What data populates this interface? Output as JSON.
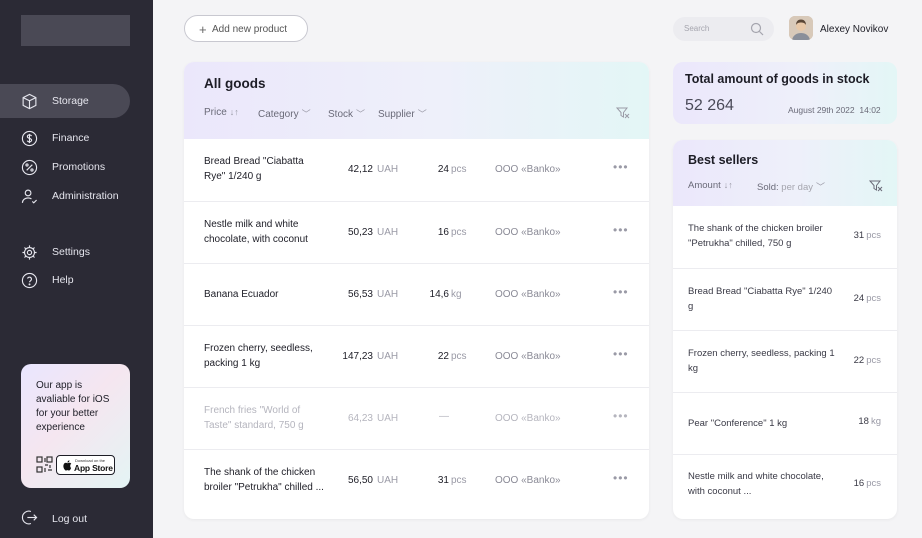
{
  "sidebar": {
    "nav": [
      {
        "label": "Storage",
        "icon": "box-icon",
        "active": true
      },
      {
        "label": "Finance",
        "icon": "dollar-icon"
      },
      {
        "label": "Promotions",
        "icon": "percent-icon"
      },
      {
        "label": "Administration",
        "icon": "user-check-icon"
      },
      {
        "label": "Settings",
        "icon": "gear-icon"
      },
      {
        "label": "Help",
        "icon": "help-icon"
      }
    ],
    "promo": {
      "text": "Our app is avaliable for iOS for your better experience",
      "store_small": "Download on the",
      "store_big": "App Store"
    },
    "logout": "Log out"
  },
  "topbar": {
    "add_button": "Add new product",
    "search_placeholder": "Search",
    "username": "Alexey Novikov"
  },
  "goods": {
    "title": "All goods",
    "filters": [
      "Price",
      "Category",
      "Stock",
      "Supplier"
    ],
    "rows": [
      {
        "name": "Bread Bread \"Ciabatta Rye\" 1/240 g",
        "price": "42,12",
        "currency": "UAH",
        "qty": "24",
        "unit": "pcs",
        "supplier": "ООО «Banko»"
      },
      {
        "name": "Nestle milk and white chocolate, with coconut",
        "price": "50,23",
        "currency": "UAH",
        "qty": "16",
        "unit": "pcs",
        "supplier": "ООО «Banko»"
      },
      {
        "name": "Banana Ecuador",
        "price": "56,53",
        "currency": "UAH",
        "qty": "14,6",
        "unit": "kg",
        "supplier": "ООО «Banko»"
      },
      {
        "name": "Frozen cherry, seedless, packing 1 kg",
        "price": "147,23",
        "currency": "UAH",
        "qty": "22",
        "unit": "pcs",
        "supplier": "ООО «Banko»"
      },
      {
        "name": "French fries \"World of Taste\" standard, 750 g",
        "price": "64,23",
        "currency": "UAH",
        "qty": "—",
        "unit": "",
        "supplier": "ООО «Banko»",
        "dim": true
      },
      {
        "name": "The shank of the chicken broiler \"Petrukha\" chilled ...",
        "price": "56,50",
        "currency": "UAH",
        "qty": "31",
        "unit": "pcs",
        "supplier": "ООО «Banko»"
      }
    ]
  },
  "total": {
    "title": "Total amount of goods in stock",
    "value": "52 264",
    "date": "August 29th 2022",
    "time": "14:02"
  },
  "best": {
    "title": "Best sellers",
    "filter_amount": "Amount",
    "filter_sold_label": "Sold:",
    "filter_sold_value": "per day",
    "rows": [
      {
        "name": "The shank of the chicken broiler \"Petrukha\" chilled, 750 g",
        "qty": "31",
        "unit": "pcs"
      },
      {
        "name": "Bread Bread \"Ciabatta Rye\" 1/240 g",
        "qty": "24",
        "unit": "pcs"
      },
      {
        "name": "Frozen cherry, seedless, packing 1 kg",
        "qty": "22",
        "unit": "pcs"
      },
      {
        "name": "Pear \"Conference\" 1 kg",
        "qty": "18",
        "unit": "kg"
      },
      {
        "name": "Nestle milk and white chocolate, with coconut ...",
        "qty": "16",
        "unit": "pcs"
      }
    ]
  },
  "colors": {
    "sidebar_bg": "#2b2a35",
    "active_item": "#4a4955",
    "card_header_gradient": [
      "#ebe7fb",
      "#e3f6f6"
    ]
  }
}
